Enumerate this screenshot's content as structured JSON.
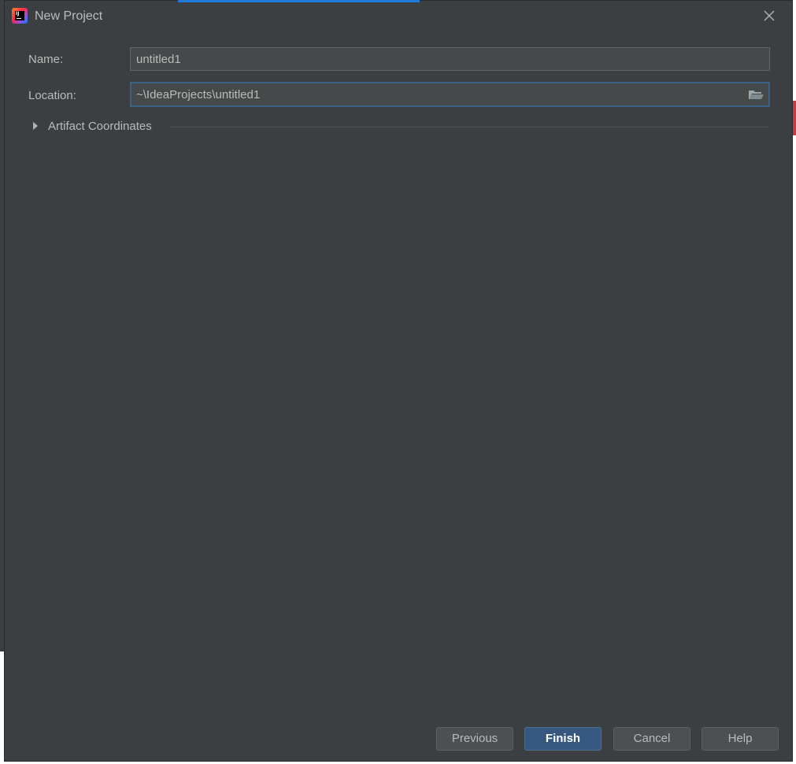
{
  "dialog": {
    "title": "New Project",
    "icon": "intellij-idea-icon"
  },
  "form": {
    "name_label": "Name:",
    "name_value": "untitled1",
    "location_label": "Location:",
    "location_value": "~\\IdeaProjects\\untitled1"
  },
  "artifact": {
    "label": "Artifact Coordinates",
    "expanded": false
  },
  "buttons": {
    "previous": "Previous",
    "finish": "Finish",
    "cancel": "Cancel",
    "help": "Help"
  },
  "colors": {
    "background": "#3c3f41",
    "input_bg": "#45494a",
    "focus_border": "#3d6185",
    "primary_button": "#365880",
    "text": "#bbbbbb"
  }
}
